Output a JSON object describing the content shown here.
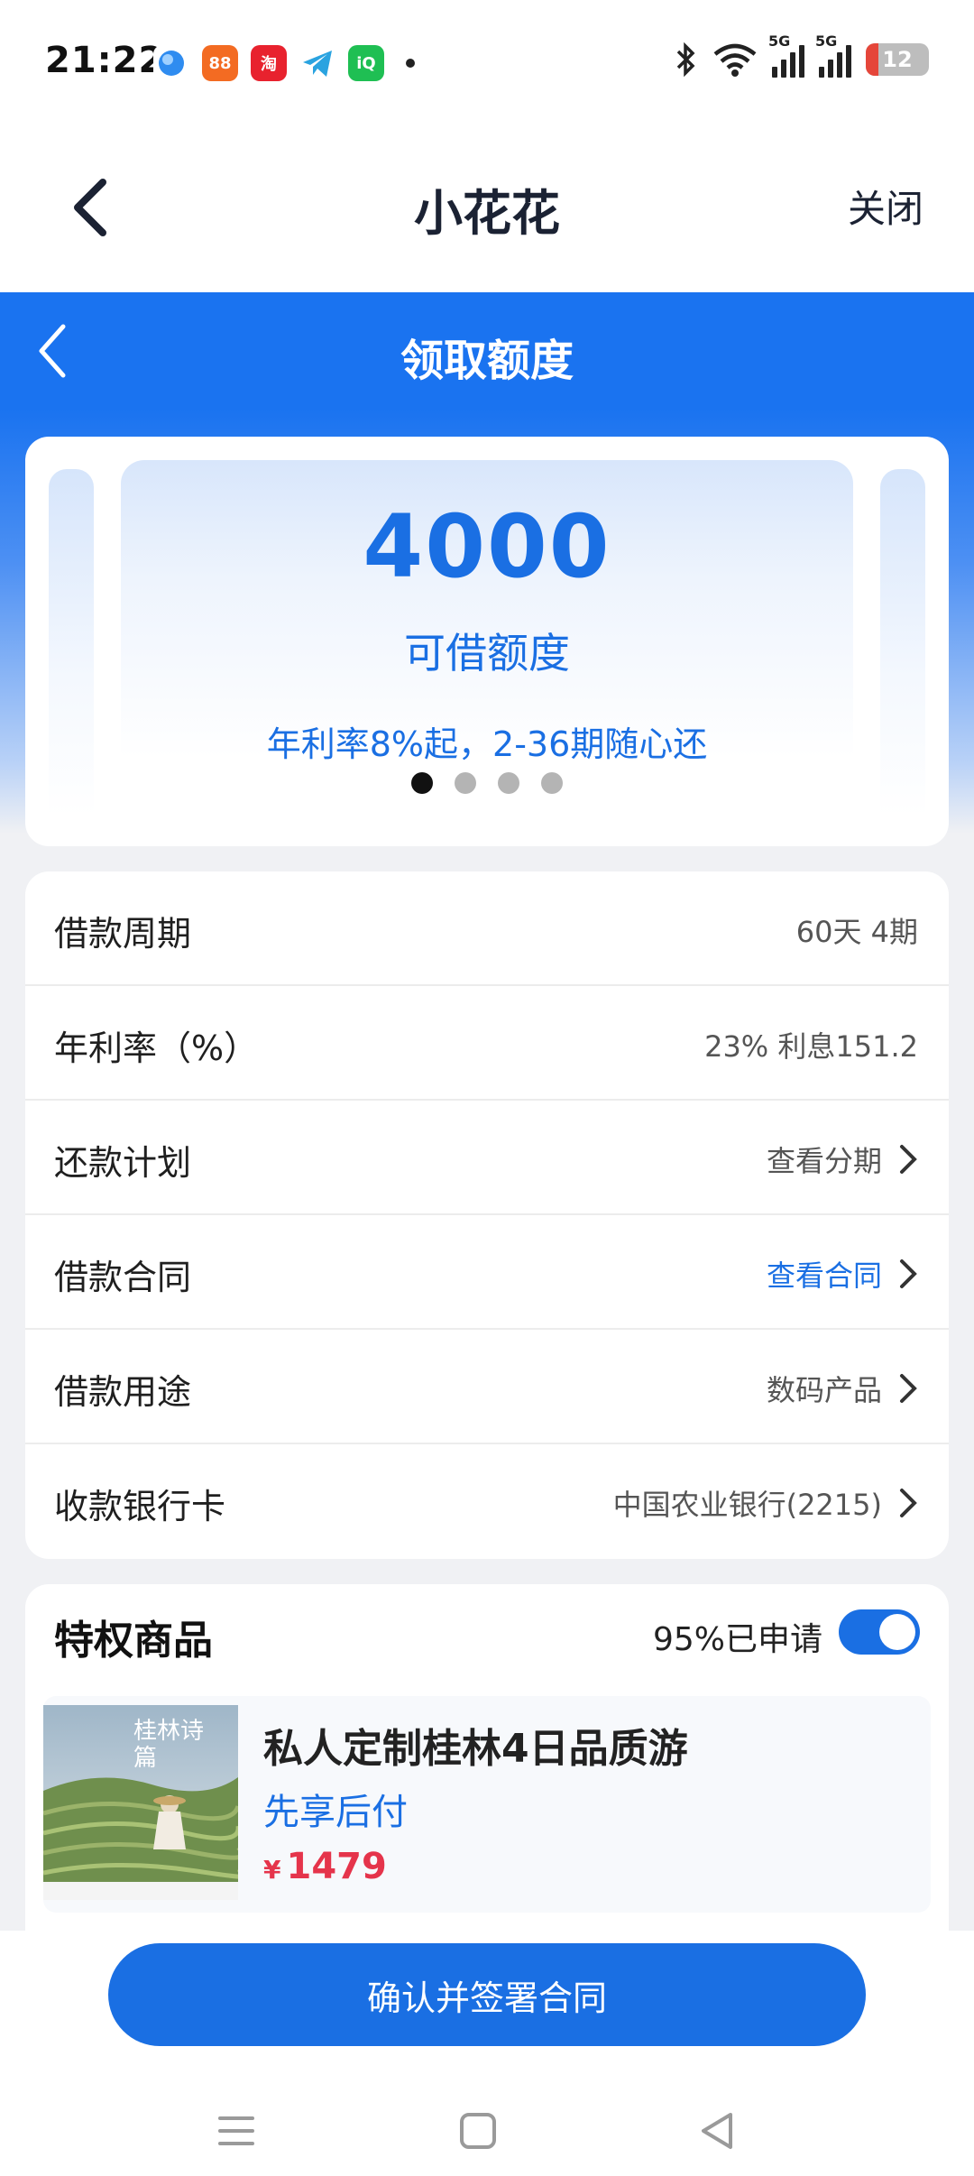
{
  "status_bar": {
    "time": "21:22",
    "apps": [
      {
        "icon": "blue-circle-app-icon",
        "color": "#2f8cf0",
        "text": ""
      },
      {
        "icon": "orange-app-icon",
        "color": "#f36b22",
        "text": "88"
      },
      {
        "icon": "taobao-icon",
        "color": "#e8222e",
        "text": "淘"
      },
      {
        "icon": "telegram-icon",
        "color": "#2aa3e0",
        "text": ""
      },
      {
        "icon": "iqiyi-icon",
        "color": "#1fbf53",
        "text": "iQ"
      }
    ],
    "network": "5G",
    "battery": "12"
  },
  "app_header": {
    "title": "小花花",
    "close_label": "关闭"
  },
  "banner": {
    "title": "领取额度"
  },
  "quota": {
    "amount": "4000",
    "label": "可借额度",
    "rate_text": "年利率8%起，2-36期随心还",
    "slide_count": 4,
    "active_slide": 1
  },
  "details": {
    "rows": [
      {
        "label": "借款周期",
        "value": "60天 4期"
      },
      {
        "label": "年利率（%）",
        "value": "23% 利息151.2"
      },
      {
        "label": "还款计划",
        "value": "查看分期"
      },
      {
        "label": "借款合同",
        "value": "查看合同"
      },
      {
        "label": "借款用途",
        "value": "数码产品"
      },
      {
        "label": "收款银行卡",
        "value": "中国农业银行(2215)"
      }
    ]
  },
  "privilege": {
    "title": "特权商品",
    "applied_text": "95%已申请",
    "toggle_on": true,
    "product": {
      "name": "私人定制桂林4日品质游",
      "tag": "先享后付",
      "currency": "¥",
      "price": "1479",
      "image_text": "桂林诗篇"
    }
  },
  "bottom": {
    "confirm_label": "确认并签署合同"
  },
  "colors": {
    "accent": "#1a6fe3",
    "price": "#e5344b",
    "banner": "#1a73f0"
  }
}
